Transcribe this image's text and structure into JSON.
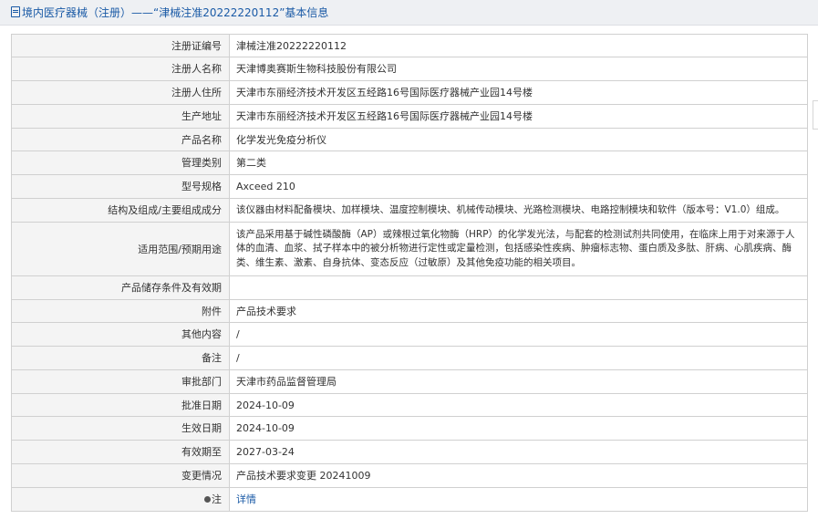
{
  "header": {
    "title": "境内医疗器械（注册）——“津械注准20222220112”基本信息"
  },
  "rows": [
    {
      "label": "注册证编号",
      "value": "津械注准20222220112"
    },
    {
      "label": "注册人名称",
      "value": "天津博奥赛斯生物科技股份有限公司"
    },
    {
      "label": "注册人住所",
      "value": "天津市东丽经济技术开发区五经路16号国际医疗器械产业园14号楼"
    },
    {
      "label": "生产地址",
      "value": "天津市东丽经济技术开发区五经路16号国际医疗器械产业园14号楼"
    },
    {
      "label": "产品名称",
      "value": "化学发光免疫分析仪"
    },
    {
      "label": "管理类别",
      "value": "第二类"
    },
    {
      "label": "型号规格",
      "value": "Axceed 210"
    },
    {
      "label": "结构及组成/主要组成成分",
      "value": "该仪器由材料配备模块、加样模块、温度控制模块、机械传动模块、光路检测模块、电路控制模块和软件（版本号：V1.0）组成。"
    },
    {
      "label": "适用范围/预期用途",
      "value": "该产品采用基于碱性磷酸酶（AP）或辣根过氧化物酶（HRP）的化学发光法，与配套的检测试剂共同使用，在临床上用于对来源于人体的血清、血浆、拭子样本中的被分析物进行定性或定量检测，包括感染性疾病、肿瘤标志物、蛋白质及多肽、肝病、心肌疾病、酶类、维生素、激素、自身抗体、变态反应（过敏原）及其他免疫功能的相关项目。"
    },
    {
      "label": "产品储存条件及有效期",
      "value": ""
    },
    {
      "label": "附件",
      "value": "产品技术要求"
    },
    {
      "label": "其他内容",
      "value": "/"
    },
    {
      "label": "备注",
      "value": "/"
    },
    {
      "label": "审批部门",
      "value": "天津市药品监督管理局"
    },
    {
      "label": "批准日期",
      "value": "2024-10-09"
    },
    {
      "label": "生效日期",
      "value": "2024-10-09"
    },
    {
      "label": "有效期至",
      "value": "2027-03-24"
    },
    {
      "label": "变更情况",
      "value": "产品技术要求变更 20241009"
    }
  ],
  "note_row": {
    "label": "注",
    "link_text": "详情",
    "icon": "info-dot-icon"
  }
}
